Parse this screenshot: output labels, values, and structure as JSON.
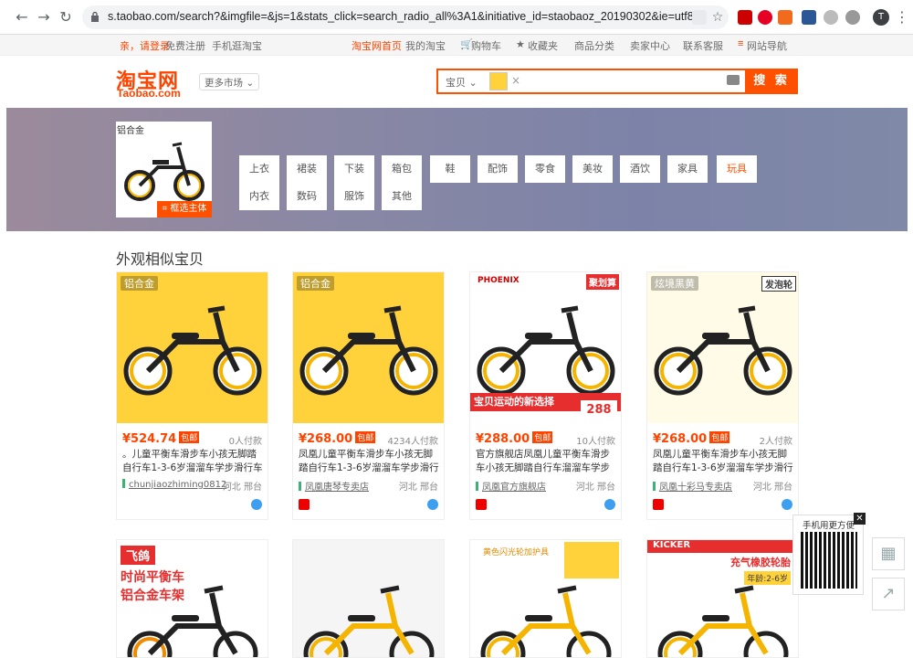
{
  "browser": {
    "url": "s.taobao.com/search?&imgfile=&js=1&stats_click=search_radio_all%3A1&initiative_id=staobaoz_20190302&ie=utf8&tfsid=TB1WjeLb...",
    "avatar_letter": "T"
  },
  "topbar": {
    "login": "亲，请登录",
    "register": "免费注册",
    "mobile": "手机逛淘宝",
    "home": "淘宝网首页",
    "my_taobao": "我的淘宝",
    "cart": "购物车",
    "favorites": "收藏夹",
    "categories": "商品分类",
    "seller_center": "卖家中心",
    "service": "联系客服",
    "site_nav": "网站导航"
  },
  "header": {
    "logo_cn": "淘宝网",
    "logo_en": "Taobao.com",
    "market": "更多市场"
  },
  "search": {
    "category": "宝贝",
    "button": "搜 索"
  },
  "banner": {
    "thumb_tag": "铝合金",
    "crop_label": "框选主体",
    "tabs": [
      {
        "top": "上衣",
        "bottom": "内衣"
      },
      {
        "top": "裙装",
        "bottom": "数码"
      },
      {
        "top": "下装",
        "bottom": "服饰"
      },
      {
        "top": "箱包",
        "bottom": "其他"
      },
      {
        "top": "鞋",
        "bottom": ""
      },
      {
        "top": "配饰",
        "bottom": ""
      },
      {
        "top": "零食",
        "bottom": ""
      },
      {
        "top": "美妆",
        "bottom": ""
      },
      {
        "top": "酒饮",
        "bottom": ""
      },
      {
        "top": "家具",
        "bottom": ""
      },
      {
        "top": "玩具",
        "bottom": ""
      }
    ]
  },
  "section_title": "外观相似宝贝",
  "products": [
    {
      "tag": "铝合金",
      "price": "¥524.74",
      "badge": "包邮",
      "sold": "0人付款",
      "title": "。儿童平衡车滑步车小孩无脚踏自行车1-3-6岁溜溜车学步滑行车",
      "shop": "chunjiaozhiming0812",
      "location": "河北 邢台"
    },
    {
      "tag": "铝合金",
      "price": "¥268.00",
      "badge": "包邮",
      "sold": "4234人付款",
      "title": "凤凰儿童平衡车滑步车小孩无脚踏自行车1-3-6岁溜溜车学步滑行车",
      "shop": "凤凰唐琴专卖店",
      "location": "河北 邢台"
    },
    {
      "tag": "PHOENIX",
      "price": "¥288.00",
      "badge": "包邮",
      "sold": "10人付款",
      "title": "官方旗舰店凤凰儿童平衡车滑步车小孩无脚踏自行车溜溜车学步滑行车",
      "shop": "凤凰官方旗舰店",
      "location": "河北 邢台",
      "promo": "宝贝运动的新选择",
      "promo_price": "288",
      "promo_top": "聚划算"
    },
    {
      "tag": "炫境黑黄",
      "price": "¥268.00",
      "badge": "包邮",
      "sold": "2人付款",
      "title": "凤凰儿童平衡车滑步车小孩无脚踏自行车1-3-6岁溜溜车学步滑行车",
      "shop": "凤凰十彩马专卖店",
      "location": "河北 邢台",
      "extra_tag": "发泡轮"
    }
  ],
  "row2": [
    {
      "brand": "飞鸽",
      "line1": "时尚平衡车",
      "line2": "铝合金车架"
    },
    {
      "brand": "",
      "line1": "",
      "line2": ""
    },
    {
      "brand": "",
      "line1": "黄色闪光轮加护具",
      "line2": ""
    },
    {
      "brand": "KICKER",
      "line1": "充气橡胶轮胎",
      "line2": "年龄:2-6岁"
    }
  ],
  "qr": {
    "text": "手机用更方便",
    "close": "✕"
  },
  "colors": {
    "accent": "#ff5000",
    "price": "#ff4400"
  }
}
